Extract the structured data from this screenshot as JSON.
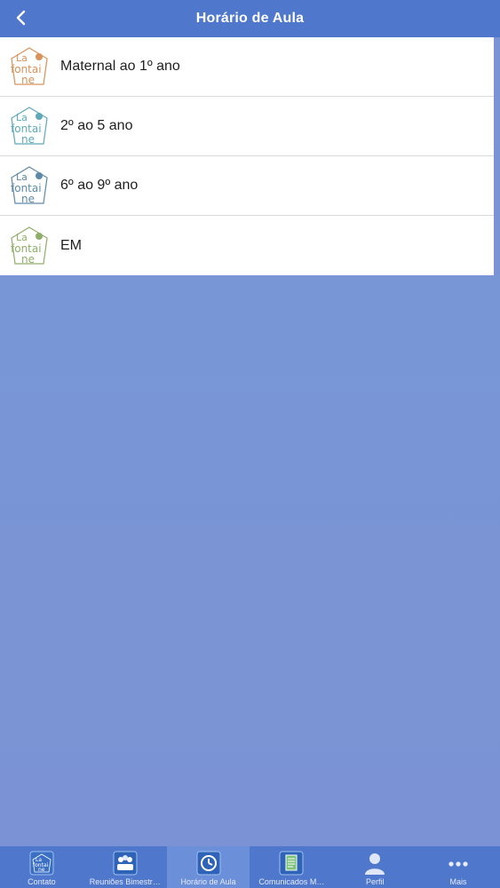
{
  "header": {
    "title": "Horário de Aula"
  },
  "items": [
    {
      "label": "Maternal ao 1º ano",
      "logo_color": "#d9925a"
    },
    {
      "label": "2º ao 5 ano",
      "logo_color": "#5fa9b8"
    },
    {
      "label": "6º ao 9º ano",
      "logo_color": "#5d8aa8"
    },
    {
      "label": "EM",
      "logo_color": "#8fae6a"
    }
  ],
  "tabbar": {
    "tabs": [
      {
        "label": "Contato",
        "icon": "school-logo-icon"
      },
      {
        "label": "Reuniões Bimestr…",
        "icon": "meeting-icon"
      },
      {
        "label": "Horário de Aula",
        "icon": "schedule-icon",
        "active": true
      },
      {
        "label": "Comunicados M…",
        "icon": "document-icon"
      },
      {
        "label": "Perfil",
        "icon": "person-icon"
      },
      {
        "label": "Mais",
        "icon": "more-icon"
      }
    ]
  },
  "logo_text": "La fontai ne",
  "colors": {
    "header": "#4f77cc",
    "background": "#7a94d4",
    "tab_active": "#6b8fd8"
  }
}
